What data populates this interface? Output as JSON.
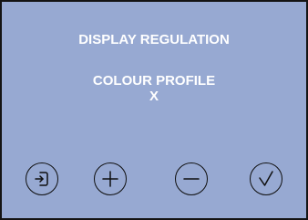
{
  "screen": {
    "title": "DISPLAY REGULATION",
    "setting_label": "COLOUR PROFILE",
    "setting_value": "X"
  },
  "buttons": [
    {
      "action": "exit",
      "icon": "exit-icon"
    },
    {
      "action": "increase",
      "icon": "plus-icon"
    },
    {
      "action": "decrease",
      "icon": "minus-icon"
    },
    {
      "action": "confirm",
      "icon": "check-icon"
    }
  ],
  "colors": {
    "background": "#97a9d2",
    "text": "#ffffff",
    "outline": "#0f0f0f"
  }
}
